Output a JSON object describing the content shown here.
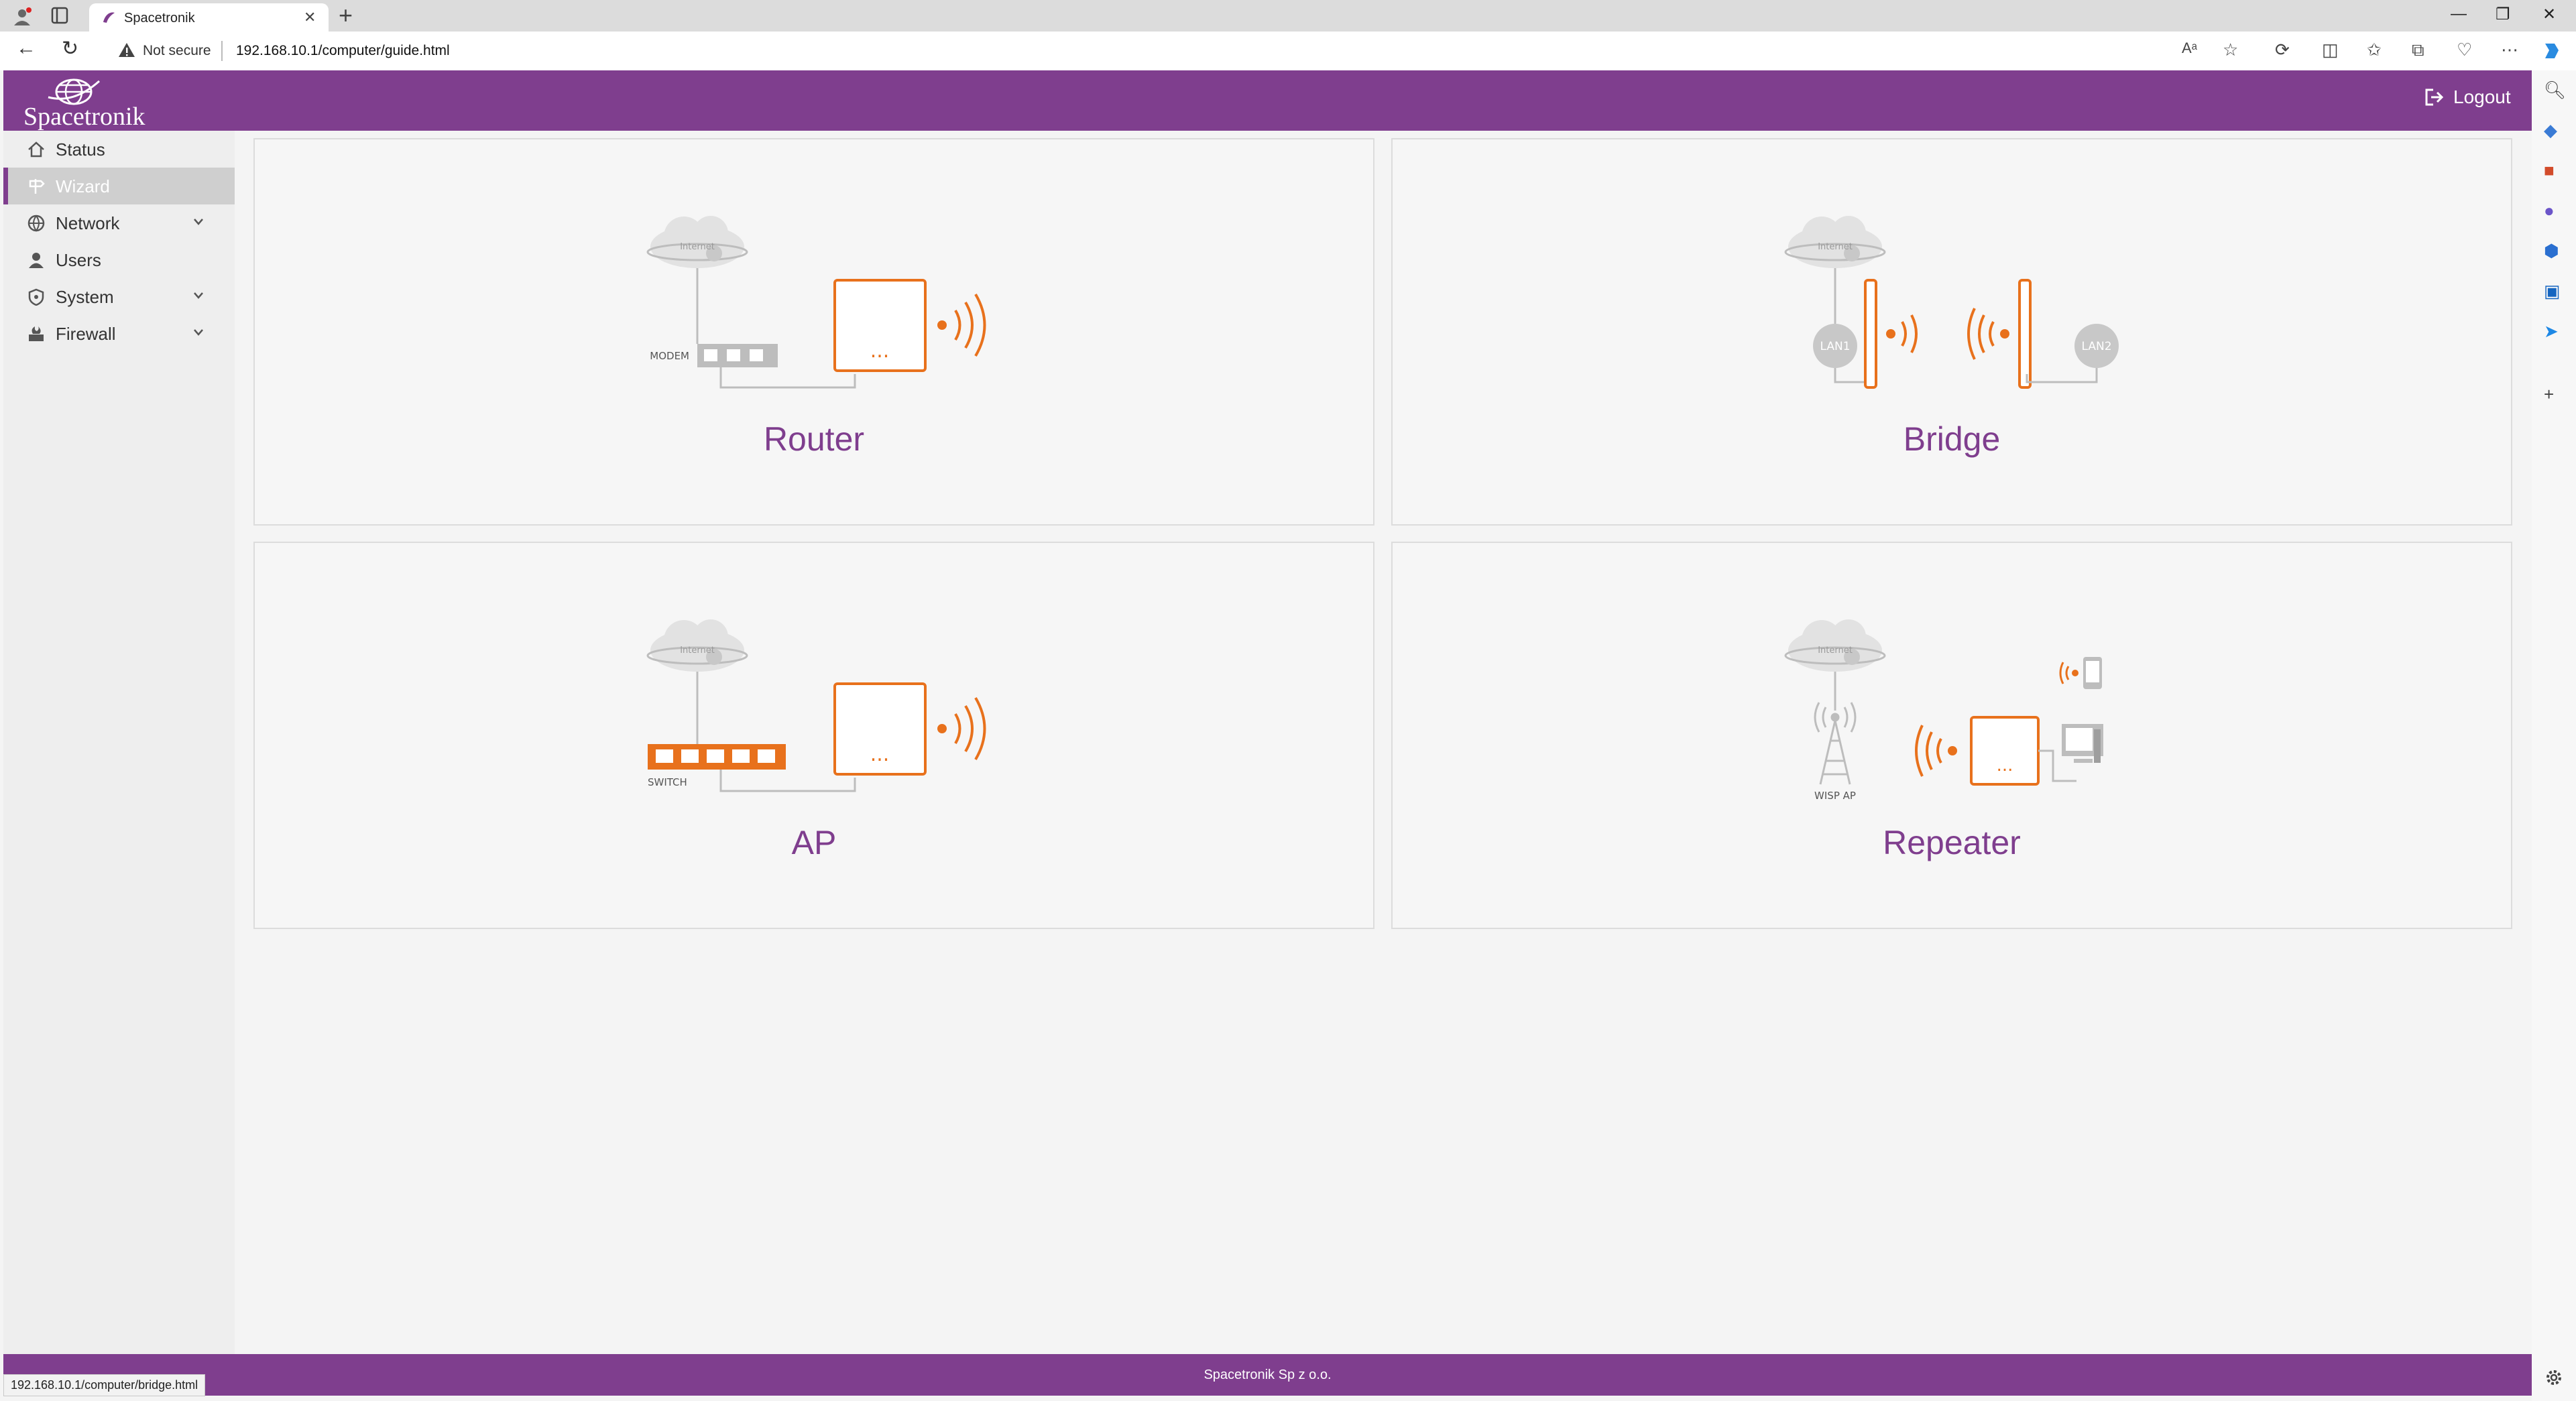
{
  "browser": {
    "tab_title": "Spacetronik",
    "address": {
      "security_label": "Not secure",
      "url": "192.168.10.1/computer/guide.html"
    },
    "status_url": "192.168.10.1/computer/bridge.html"
  },
  "header": {
    "logo_text": "Spacetronik",
    "logout_label": "Logout"
  },
  "sidebar": {
    "items": [
      {
        "label": "Status",
        "icon": "home-icon",
        "has_submenu": false,
        "active": false
      },
      {
        "label": "Wizard",
        "icon": "signpost-icon",
        "has_submenu": false,
        "active": true
      },
      {
        "label": "Network",
        "icon": "globe-icon",
        "has_submenu": true,
        "active": false
      },
      {
        "label": "Users",
        "icon": "user-icon",
        "has_submenu": false,
        "active": false
      },
      {
        "label": "System",
        "icon": "shield-icon",
        "has_submenu": true,
        "active": false
      },
      {
        "label": "Firewall",
        "icon": "firewall-icon",
        "has_submenu": true,
        "active": false
      }
    ]
  },
  "modes": [
    {
      "title": "Router",
      "labels": {
        "cloud": "Internet",
        "device": "MODEM",
        "box": "..."
      }
    },
    {
      "title": "Bridge",
      "labels": {
        "cloud": "Internet",
        "left_node": "LAN1",
        "right_node": "LAN2"
      }
    },
    {
      "title": "AP",
      "labels": {
        "cloud": "Internet",
        "device": "SWITCH",
        "box": "..."
      }
    },
    {
      "title": "Repeater",
      "labels": {
        "cloud": "Internet",
        "tower": "WISP AP",
        "box": "..."
      }
    }
  ],
  "footer": {
    "text": "Spacetronik Sp z o.o."
  },
  "colors": {
    "brand": "#7f3e8e",
    "accent": "#e8711c",
    "gray": "#bdbdbd"
  }
}
